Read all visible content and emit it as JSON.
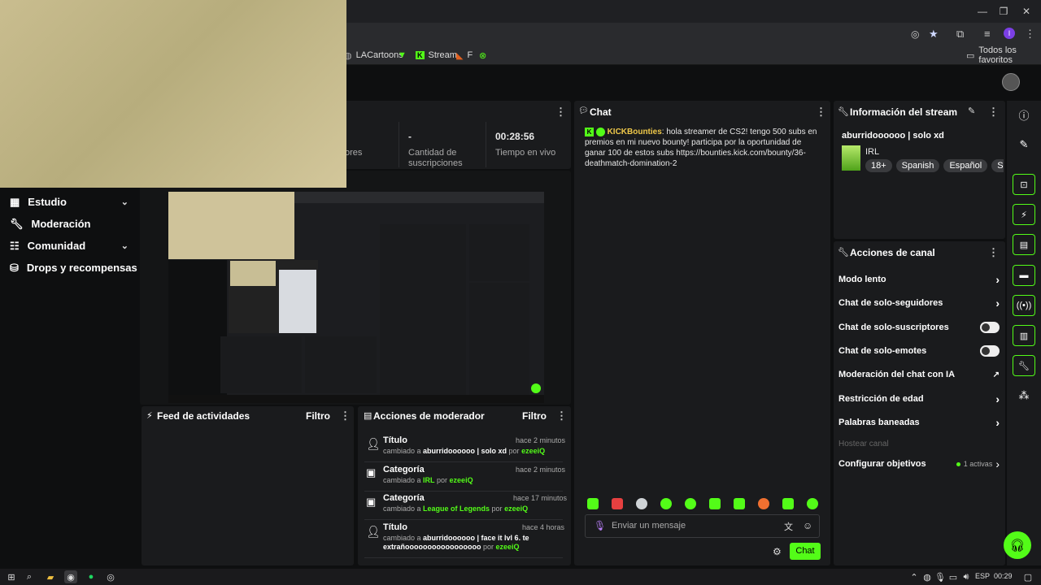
{
  "bookmarks": [
    {
      "label": "LACartoons",
      "icon": "globe-icon"
    },
    {
      "label": "",
      "icon": "kick-icon"
    },
    {
      "label": "Stream",
      "icon": "kick-icon"
    },
    {
      "label": "F",
      "icon": "app-icon"
    },
    {
      "label": "",
      "icon": "xbox-icon"
    }
  ],
  "favorites_label": "Todos los favoritos",
  "stats": {
    "followers_label_partial": "ores",
    "subs_value": "-",
    "subs_label": "Cantidad de suscripciones",
    "time_value": "00:28:56",
    "time_label": "Tiempo en vivo"
  },
  "nav": [
    {
      "label": "Estudio",
      "icon": "dashboard-icon",
      "chevron": true
    },
    {
      "label": "Moderación",
      "icon": "wrench-icon",
      "chevron": false
    },
    {
      "label": "Comunidad",
      "icon": "community-icon",
      "chevron": true
    },
    {
      "label": "Drops y recompensas",
      "icon": "drops-icon",
      "chevron": false
    }
  ],
  "activity_feed": {
    "title": "Feed de actividades",
    "filter": "Filtro"
  },
  "mod_actions": {
    "title": "Acciones de moderador",
    "filter": "Filtro",
    "items": [
      {
        "type": "Título",
        "time": "hace 2 minutos",
        "pre": "cambiado a ",
        "value": "aburridoooooo | solo xd",
        "mid": " por ",
        "user": "ezeeiQ"
      },
      {
        "type": "Categoría",
        "time": "hace 2 minutos",
        "pre": "cambiado a ",
        "value": "IRL",
        "mid": " por ",
        "user": "ezeeiQ"
      },
      {
        "type": "Categoría",
        "time": "hace 17 minutos",
        "pre": "cambiado a ",
        "value": "League of Legends",
        "mid": " por ",
        "user": "ezeeiQ"
      },
      {
        "type": "Título",
        "time": "hace 4 horas",
        "pre": "cambiado a ",
        "value": "aburridoooooo | face it lvl 6. te extrañooooooooooooooooo",
        "mid": " por ",
        "user": "ezeeiQ"
      }
    ]
  },
  "chat": {
    "title": "Chat",
    "message": {
      "user": "KICKBounties",
      "text": ": hola streamer de CS2! tengo 500 subs en premios en mi nuevo bounty! participa por la oportunidad de ganar 100 de estos subs https://bounties.kick.com/bounty/36-deathmatch-domination-2"
    },
    "placeholder": "Enviar un mensaje",
    "send_label": "Chat"
  },
  "stream_info": {
    "title": "Información del stream",
    "stream_title": "aburridoooooo | solo xd",
    "category": "IRL",
    "tags": [
      "18+",
      "Spanish",
      "Español",
      "Shoo"
    ]
  },
  "channel_actions": {
    "title": "Acciones de canal",
    "items": [
      {
        "label": "Modo lento",
        "control": "chevron"
      },
      {
        "label": "Chat de solo-seguidores",
        "control": "chevron"
      },
      {
        "label": "Chat de solo-suscriptores",
        "control": "toggle"
      },
      {
        "label": "Chat de solo-emotes",
        "control": "toggle"
      },
      {
        "label": "Moderación del chat con IA",
        "control": "external"
      },
      {
        "label": "Restricción de edad",
        "control": "chevron"
      },
      {
        "label": "Palabras baneadas",
        "control": "chevron"
      }
    ],
    "host_label": "Hostear canal",
    "goals_label": "Configurar objetivos",
    "goals_status": "1 activas"
  },
  "taskbar": {
    "lang": "ESP",
    "time": "00:29"
  },
  "colors": {
    "accent": "#53fc18",
    "panel": "#1a1b1d",
    "background": "#0e0f10"
  }
}
